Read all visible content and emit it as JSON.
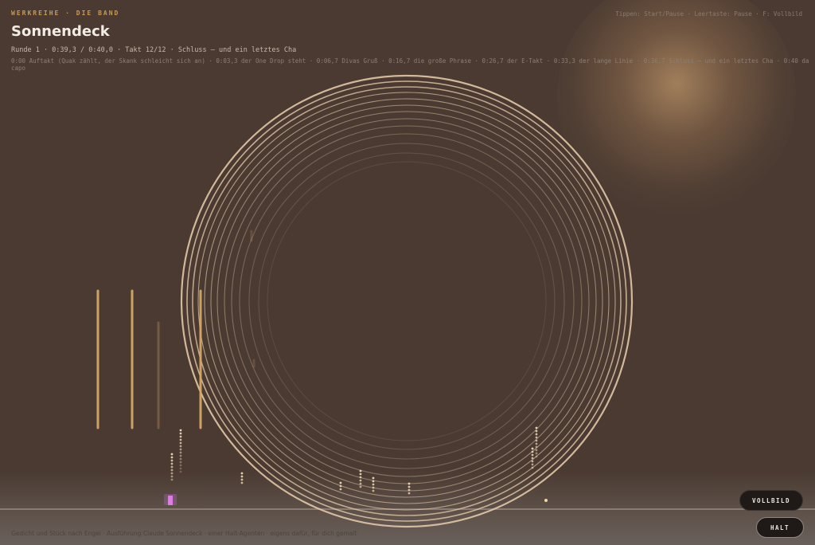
{
  "header": {
    "eyebrow": "WERKREIHE · DIE BAND",
    "title": "Sonnendeck",
    "status": "Runde 1 · 0:39,3 / 0:40,0 · Takt 12/12 · Schluss — und ein letztes Cha",
    "timeline": "0:00 Auftakt (Quak zählt, der Skank schleicht sich an) · 0:03,3 der One Drop steht · 0:06,7 Divas Gruß · 0:16,7 die große Phrase · 0:26,7 der E-Takt · 0:33,3 der lange Linie · 0:36,7 Schluss — und ein letztes Cha · 0:40 da capo",
    "hint": "Tippen: Start/Pause · Leertaste: Pause · F: Vollbild"
  },
  "buttons": {
    "fullscreen": "VOLLBILD",
    "halt": "HALT"
  },
  "credits": "Gedicht und Stück nach Engel · Ausführung Claude Sonnendeck · einer Halt-Agenten · eigens dafür, für dich gemalt",
  "colors": {
    "background": "#4a3a31",
    "ring": "#e2c6a6",
    "bar": "#d4a867",
    "accent": "#d070e0"
  },
  "visual": {
    "icons": [
      "ring-visualizer",
      "level-bars",
      "particle-streams",
      "playhead-marker"
    ]
  }
}
